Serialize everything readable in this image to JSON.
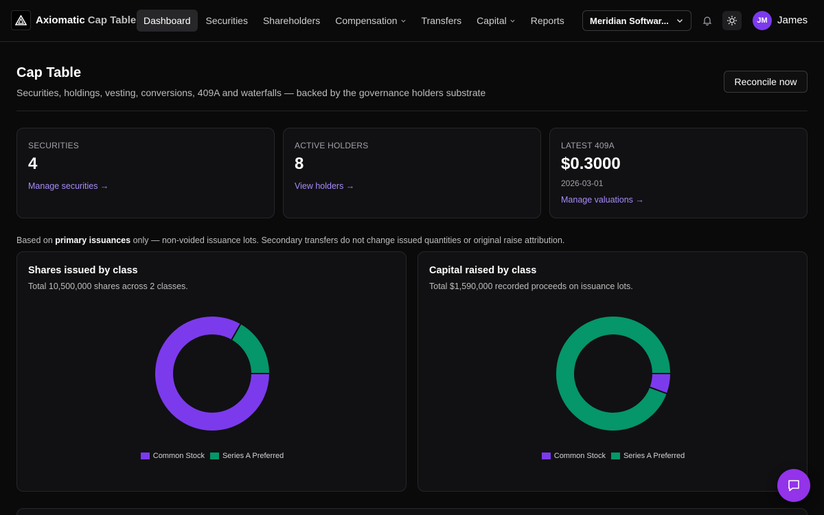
{
  "brand": {
    "name": "Axiomatic",
    "product": "Cap Table",
    "logo_icon": "triangle-logo-icon"
  },
  "nav": {
    "items": [
      {
        "label": "Dashboard",
        "active": true,
        "dropdown": false
      },
      {
        "label": "Securities",
        "active": false,
        "dropdown": false
      },
      {
        "label": "Shareholders",
        "active": false,
        "dropdown": false
      },
      {
        "label": "Compensation",
        "active": false,
        "dropdown": true
      },
      {
        "label": "Transfers",
        "active": false,
        "dropdown": false
      },
      {
        "label": "Capital",
        "active": false,
        "dropdown": true
      },
      {
        "label": "Reports",
        "active": false,
        "dropdown": false
      }
    ]
  },
  "org_selector": {
    "value": "Meridian Softwar..."
  },
  "user": {
    "initials": "JM",
    "name": "James",
    "avatar_color": "#7c3aed"
  },
  "header": {
    "title": "Cap Table",
    "subtitle": "Securities, holdings, vesting, conversions, 409A and waterfalls — backed by the governance holders substrate",
    "reconcile_label": "Reconcile now"
  },
  "stats": [
    {
      "label": "SECURITIES",
      "value": "4",
      "link": "Manage securities →"
    },
    {
      "label": "ACTIVE HOLDERS",
      "value": "8",
      "link": "View holders →"
    },
    {
      "label": "LATEST 409A",
      "value": "$0.3000",
      "date": "2026-03-01",
      "link": "Manage valuations →"
    }
  ],
  "note": {
    "prefix": "Based on ",
    "bold": "primary issuances",
    "suffix": " only — non-voided issuance lots. Secondary transfers do not change issued quantities or original raise attribution."
  },
  "colors": {
    "common": "#7c3aed",
    "preferred": "#059669",
    "accent_link": "#a78bfa"
  },
  "chart_data": [
    {
      "type": "pie",
      "title": "Shares issued by class",
      "subtitle": "Total 10,500,000 shares across 2 classes.",
      "categories": [
        "Common Stock",
        "Series A Preferred"
      ],
      "values": [
        0.833,
        0.167
      ],
      "colors": [
        "#7c3aed",
        "#059669"
      ],
      "legend": "bottom"
    },
    {
      "type": "pie",
      "title": "Capital raised by class",
      "subtitle": "Total $1,590,000 recorded proceeds on issuance lots.",
      "categories": [
        "Common Stock",
        "Series A Preferred"
      ],
      "values": [
        0.057,
        0.943
      ],
      "colors": [
        "#7c3aed",
        "#059669"
      ],
      "legend": "bottom"
    }
  ],
  "chat": {
    "icon": "chat-bubble-icon"
  }
}
